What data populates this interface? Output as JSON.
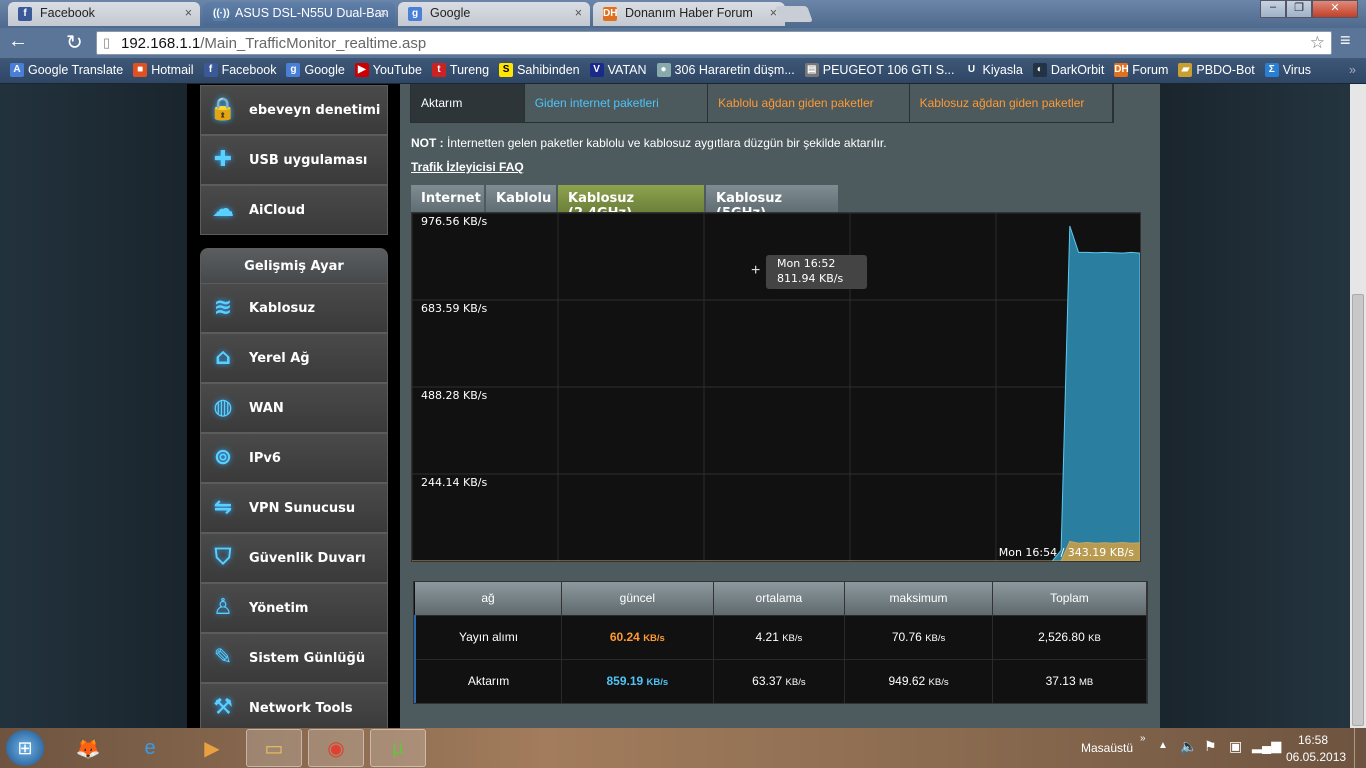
{
  "browser": {
    "tabs": [
      {
        "title": "Facebook",
        "icon": "facebook-icon",
        "color": "#3b5998",
        "glyph": "f"
      },
      {
        "title": "ASUS DSL-N55U Dual-Ban",
        "icon": "wifi-icon",
        "color": "#5a7fa8",
        "glyph": "((·))"
      },
      {
        "title": "Google",
        "icon": "google-icon",
        "color": "#4a7fd8",
        "glyph": "g"
      },
      {
        "title": "Donanım Haber Forum",
        "icon": "dh-icon",
        "color": "#e07020",
        "glyph": "DH"
      }
    ],
    "url_host": "192.168.1.1",
    "url_path": "/Main_TrafficMonitor_realtime.asp",
    "bookmarks": [
      {
        "label": "Google Translate",
        "color": "#4a7fd8",
        "glyph": "A"
      },
      {
        "label": "Hotmail",
        "color": "#e05020",
        "glyph": "■"
      },
      {
        "label": "Facebook",
        "color": "#3b5998",
        "glyph": "f"
      },
      {
        "label": "Google",
        "color": "#4a7fd8",
        "glyph": "g"
      },
      {
        "label": "YouTube",
        "color": "#c00",
        "glyph": "▶"
      },
      {
        "label": "Tureng",
        "color": "#c22",
        "glyph": "t"
      },
      {
        "label": "Sahibinden",
        "color": "#ffe600",
        "glyph": "S"
      },
      {
        "label": "VATAN",
        "color": "#1a2a8a",
        "glyph": "V"
      },
      {
        "label": "306 Hararetin düşm...",
        "color": "#8aa",
        "glyph": "●"
      },
      {
        "label": "PEUGEOT 106 GTI S...",
        "color": "#777",
        "glyph": "▤"
      },
      {
        "label": "Kiyasla",
        "color": "transparent",
        "glyph": "U"
      },
      {
        "label": "DarkOrbit",
        "color": "#234",
        "glyph": "◐"
      },
      {
        "label": "Forum",
        "color": "#e07020",
        "glyph": "DH"
      },
      {
        "label": "PBDO-Bot",
        "color": "#c9a030",
        "glyph": "▰"
      },
      {
        "label": "Virus",
        "color": "#2a7fd0",
        "glyph": "Σ"
      }
    ],
    "more": "»"
  },
  "sidebar": {
    "items_top": [
      {
        "label": "ebeveyn denetimi",
        "icon": "lock-icon",
        "glyph": "🔒"
      },
      {
        "label": "USB uygulaması",
        "icon": "puzzle-icon",
        "glyph": "✚"
      },
      {
        "label": "AiCloud",
        "icon": "cloud-home-icon",
        "glyph": "☁"
      }
    ],
    "advanced_header": "Gelişmiş Ayar",
    "items": [
      {
        "label": "Kablosuz",
        "icon": "wifi-icon",
        "glyph": "≋"
      },
      {
        "label": "Yerel Ağ",
        "icon": "home-icon",
        "glyph": "⌂"
      },
      {
        "label": "WAN",
        "icon": "globe-icon",
        "glyph": "◍"
      },
      {
        "label": "IPv6",
        "icon": "ipv6-icon",
        "glyph": "⊚"
      },
      {
        "label": "VPN Sunucusu",
        "icon": "vpn-icon",
        "glyph": "⇋"
      },
      {
        "label": "Güvenlik Duvarı",
        "icon": "shield-icon",
        "glyph": "⛉"
      },
      {
        "label": "Yönetim",
        "icon": "user-icon",
        "glyph": "♙"
      },
      {
        "label": "Sistem Günlüğü",
        "icon": "log-edit-icon",
        "glyph": "✎"
      },
      {
        "label": "Network Tools",
        "icon": "tools-icon",
        "glyph": "⚒"
      }
    ]
  },
  "main": {
    "legend": [
      {
        "label": "Aktarım",
        "color": "#ffffff"
      },
      {
        "label": "Giden internet paketleri",
        "color": "#4fc3f7"
      },
      {
        "label": "Kablolu ağdan giden paketler",
        "color": "#ff9933"
      },
      {
        "label": "Kablosuz ağdan giden paketler",
        "color": "#ff9933"
      }
    ],
    "note_label": "NOT :",
    "note_text": " İnternetten gelen paketler kablolu ve kablosuz aygıtlara düzgün bir şekilde aktarılır.",
    "faq_link": "Trafik İzleyicisi FAQ",
    "tabs": [
      "Internet",
      "Kablolu",
      "Kablosuz (2.4GHz)",
      "Kablosuz (5GHz)"
    ],
    "active_tab": "Kablosuz (2.4GHz)",
    "stats": {
      "headers": [
        "ağ",
        "güncel",
        "ortalama",
        "maksimum",
        "Toplam"
      ],
      "rows": [
        {
          "name": "Yayın alımı",
          "current": "60.24",
          "current_unit": "KB/s",
          "current_color": "#ff9933",
          "avg": "4.21",
          "avg_unit": "KB/s",
          "max": "70.76",
          "max_unit": "KB/s",
          "total": "2,526.80",
          "total_unit": "KB"
        },
        {
          "name": "Aktarım",
          "current": "859.19",
          "current_unit": "KB/s",
          "current_color": "#4fc3f7",
          "avg": "63.37",
          "avg_unit": "KB/s",
          "max": "949.62",
          "max_unit": "KB/s",
          "total": "37.13",
          "total_unit": "MB"
        }
      ]
    }
  },
  "chart_data": {
    "type": "area",
    "ylabels": [
      "976.56 KB/s",
      "683.59 KB/s",
      "488.28 KB/s",
      "244.14 KB/s"
    ],
    "ylim": [
      0,
      976.56
    ],
    "grid": true,
    "series": [
      {
        "color": "#2a7fa0",
        "values": [
          0,
          0,
          0,
          0,
          0,
          0,
          0,
          0,
          0,
          0,
          0,
          0,
          0,
          0,
          0,
          0,
          0,
          0,
          0,
          0,
          0,
          0,
          0,
          0,
          0,
          0,
          0,
          0,
          0,
          0,
          0,
          0,
          0,
          0,
          0,
          0,
          0,
          0,
          0,
          0,
          0,
          0,
          0,
          0,
          0,
          0,
          0,
          0,
          0,
          0,
          0,
          0,
          0,
          0,
          0,
          0,
          0,
          0,
          0,
          0,
          0,
          0,
          0,
          0,
          0,
          0,
          0,
          0,
          0,
          0,
          0,
          0,
          0,
          0,
          30,
          940,
          866,
          866,
          865,
          866,
          865,
          864,
          866,
          864
        ]
      },
      {
        "color": "#b89a50",
        "values": [
          0,
          0,
          0,
          0,
          0,
          0,
          0,
          0,
          0,
          0,
          0,
          0,
          0,
          0,
          0,
          0,
          0,
          0,
          0,
          0,
          0,
          0,
          0,
          0,
          0,
          0,
          0,
          0,
          0,
          0,
          0,
          0,
          0,
          0,
          0,
          0,
          0,
          0,
          0,
          0,
          0,
          0,
          0,
          0,
          0,
          0,
          0,
          0,
          0,
          0,
          0,
          0,
          0,
          0,
          0,
          0,
          0,
          0,
          0,
          0,
          0,
          0,
          0,
          0,
          0,
          0,
          0,
          0,
          0,
          0,
          0,
          0,
          0,
          0,
          0,
          55,
          50,
          52,
          50,
          51,
          50,
          52,
          50,
          51
        ]
      }
    ],
    "tooltip": {
      "time": "Mon 16:52",
      "value": "811.94 KB/s"
    },
    "status": "Mon 16:54 / 343.19 KB/s"
  },
  "taskbar": {
    "apps": [
      {
        "name": "firefox",
        "glyph": "🦊",
        "open": false
      },
      {
        "name": "internet-explorer",
        "glyph": "e",
        "open": false
      },
      {
        "name": "media-player",
        "glyph": "▶",
        "open": false
      },
      {
        "name": "file-explorer",
        "glyph": "▭",
        "open": true
      },
      {
        "name": "chrome",
        "glyph": "◉",
        "open": true
      },
      {
        "name": "utorrent",
        "glyph": "µ",
        "open": true
      }
    ],
    "desktop_label": "Masaüstü",
    "expand": "»",
    "time": "16:58",
    "date": "06.05.2013"
  }
}
